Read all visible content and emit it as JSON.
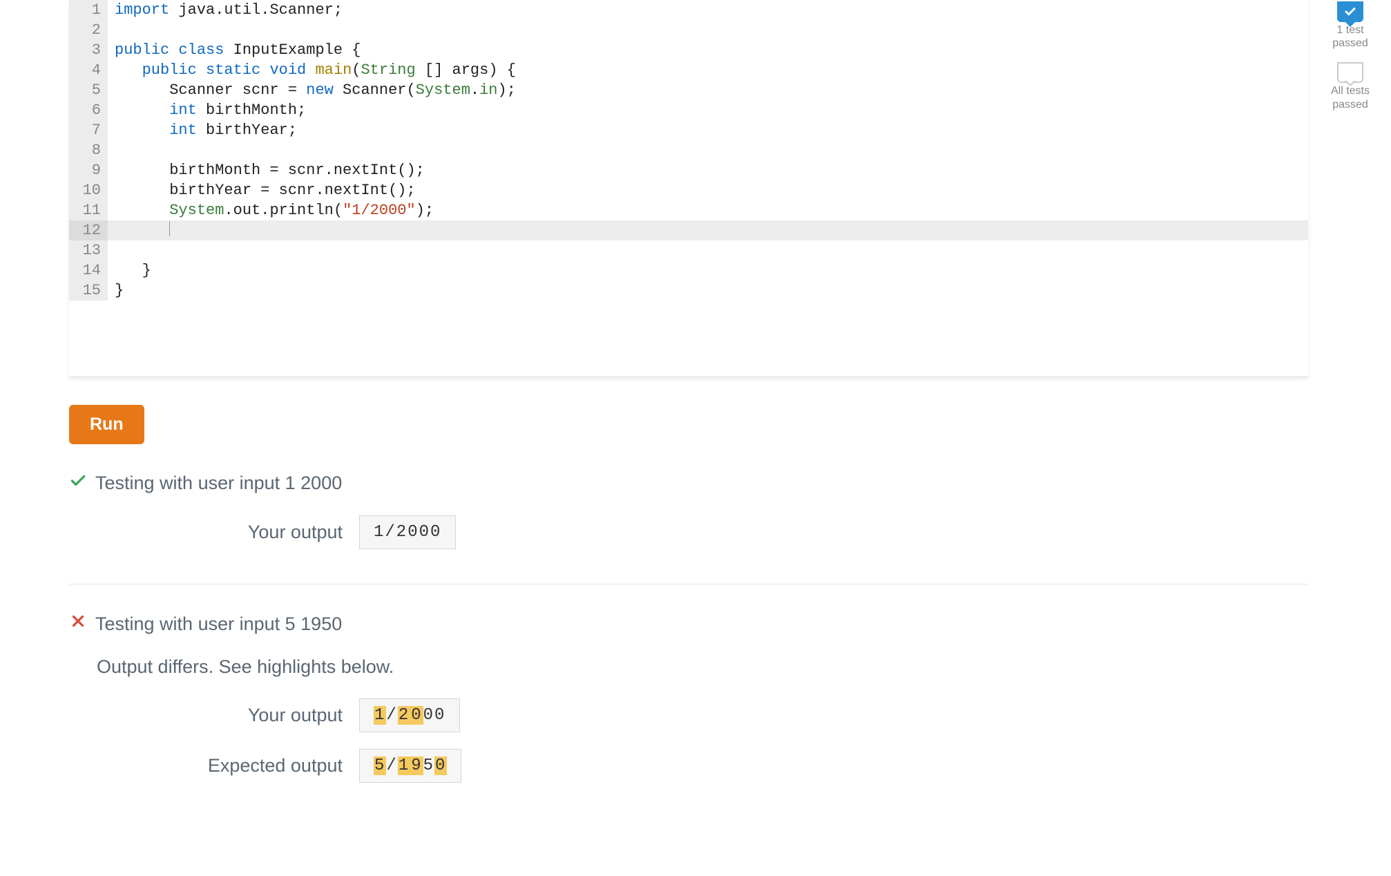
{
  "sidebar": {
    "badge1": {
      "label": "1 test\npassed"
    },
    "badge2": {
      "label": "All tests\npassed"
    }
  },
  "editor": {
    "lines": [
      [
        {
          "t": "import",
          "c": "kw"
        },
        {
          "t": " java.util.Scanner;"
        }
      ],
      [],
      [
        {
          "t": "public",
          "c": "kw"
        },
        {
          "t": " "
        },
        {
          "t": "class",
          "c": "kw"
        },
        {
          "t": " InputExample {"
        }
      ],
      [
        {
          "t": "   "
        },
        {
          "t": "public",
          "c": "kw"
        },
        {
          "t": " "
        },
        {
          "t": "static",
          "c": "kw"
        },
        {
          "t": " "
        },
        {
          "t": "void",
          "c": "kw"
        },
        {
          "t": " "
        },
        {
          "t": "main",
          "c": "func"
        },
        {
          "t": "("
        },
        {
          "t": "String",
          "c": "sys"
        },
        {
          "t": " [] args) {"
        }
      ],
      [
        {
          "t": "      Scanner scnr = "
        },
        {
          "t": "new",
          "c": "kw"
        },
        {
          "t": " Scanner("
        },
        {
          "t": "System",
          "c": "sys"
        },
        {
          "t": "."
        },
        {
          "t": "in",
          "c": "sys"
        },
        {
          "t": ");"
        }
      ],
      [
        {
          "t": "      "
        },
        {
          "t": "int",
          "c": "type"
        },
        {
          "t": " birthMonth;"
        }
      ],
      [
        {
          "t": "      "
        },
        {
          "t": "int",
          "c": "type"
        },
        {
          "t": " birthYear;"
        }
      ],
      [],
      [
        {
          "t": "      birthMonth = scnr.nextInt();"
        }
      ],
      [
        {
          "t": "      birthYear = scnr.nextInt();"
        }
      ],
      [
        {
          "t": "      "
        },
        {
          "t": "System",
          "c": "sys"
        },
        {
          "t": ".out.println("
        },
        {
          "t": "\"1/2000\"",
          "c": "str"
        },
        {
          "t": ");"
        }
      ],
      [
        {
          "t": "      ",
          "cursor": true
        }
      ],
      [],
      [
        {
          "t": "   }"
        }
      ],
      [
        {
          "t": "}"
        }
      ]
    ],
    "active_line": 12
  },
  "run_label": "Run",
  "tests": [
    {
      "pass": true,
      "title": "Testing with user input 1 2000",
      "rows": [
        {
          "label": "Your output",
          "content": [
            {
              "t": "1/2000"
            }
          ]
        }
      ]
    },
    {
      "pass": false,
      "title": "Testing with user input 5 1950",
      "diff_msg": "Output differs. See highlights below.",
      "rows": [
        {
          "label": "Your output",
          "content": [
            {
              "t": "1",
              "hl": true
            },
            {
              "t": "/"
            },
            {
              "t": "2",
              "hl": true
            },
            {
              "t": "0",
              "hl": true
            },
            {
              "t": "00"
            }
          ]
        },
        {
          "label": "Expected output",
          "content": [
            {
              "t": "5",
              "hl": true
            },
            {
              "t": "/"
            },
            {
              "t": "1",
              "hl": true
            },
            {
              "t": "9",
              "hl": true
            },
            {
              "t": "5"
            },
            {
              "t": "0",
              "hl": true
            }
          ]
        }
      ]
    }
  ]
}
